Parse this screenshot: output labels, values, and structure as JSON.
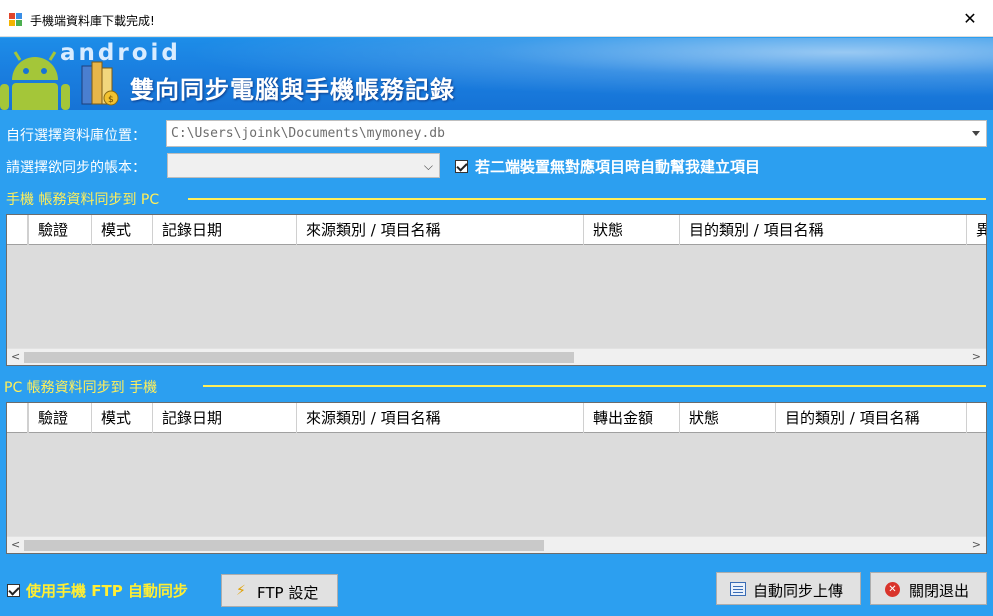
{
  "window": {
    "title": "手機端資料庫下載完成!"
  },
  "banner": {
    "brand": "android",
    "title": "雙向同步電腦與手機帳務記錄"
  },
  "db": {
    "label": "自行選擇資料庫位置：",
    "path": "C:\\Users\\joink\\Documents\\mymoney.db"
  },
  "account": {
    "label": "請選擇欲同步的帳本：",
    "value": ""
  },
  "auto_create": {
    "label": "若二端裝置無對應項目時自動幫我建立項目",
    "checked": true
  },
  "phone_to_pc": {
    "title": "手機 帳務資料同步到 PC",
    "columns": [
      "驗證",
      "模式",
      "記錄日期",
      "來源類別 / 項目名稱",
      "狀態",
      "目的類別 / 項目名稱",
      "異"
    ],
    "rows": []
  },
  "pc_to_phone": {
    "title": "PC 帳務資料同步到 手機",
    "columns": [
      "驗證",
      "模式",
      "記錄日期",
      "來源類別 / 項目名稱",
      "轉出金額",
      "狀態",
      "目的類別 / 項目名稱"
    ],
    "rows": []
  },
  "footer": {
    "ftp_auto_label": "使用手機 FTP 自動同步",
    "ftp_auto_checked": true,
    "ftp_settings_label": "FTP 設定",
    "auto_upload_label": "自動同步上傳",
    "close_label": "關閉退出"
  },
  "icons": {
    "close": "close-x-icon",
    "ftp": "lightning-icon",
    "upload": "table-icon",
    "exit": "cancel-circle-icon"
  }
}
